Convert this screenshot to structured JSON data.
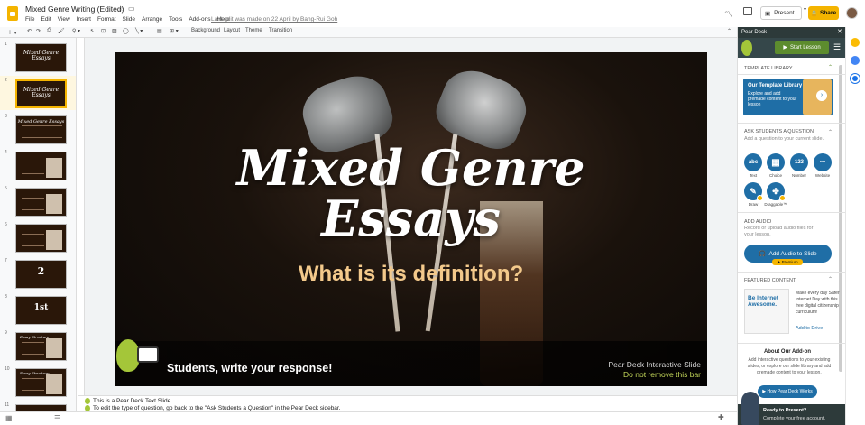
{
  "titlebar": {
    "doc_title": "Mixed Genre Writing (Edited)",
    "menus": [
      "File",
      "Edit",
      "View",
      "Insert",
      "Format",
      "Slide",
      "Arrange",
      "Tools",
      "Add-ons",
      "Help"
    ],
    "last_edit": "Last edit was made on 22 April by Bang-Rui Goh",
    "present_label": "Present",
    "share_label": "Share"
  },
  "toolbar": {
    "background_label": "Background",
    "layout_label": "Layout",
    "theme_label": "Theme",
    "transition_label": "Transition"
  },
  "slides": [
    {
      "num": "1",
      "title": "Mixed Genre Essays",
      "kind": "title"
    },
    {
      "num": "2",
      "title": "Mixed Genre Essays",
      "kind": "title"
    },
    {
      "num": "3",
      "title": "Mixed Genre Essays",
      "kind": "text"
    },
    {
      "num": "4",
      "title": "",
      "kind": "text-image"
    },
    {
      "num": "5",
      "title": "",
      "kind": "text-image"
    },
    {
      "num": "6",
      "title": "",
      "kind": "text-image"
    },
    {
      "num": "7",
      "title": "2",
      "kind": "number"
    },
    {
      "num": "8",
      "title": "1st",
      "kind": "number"
    },
    {
      "num": "9",
      "title": "Essay Structure",
      "kind": "text-image"
    },
    {
      "num": "10",
      "title": "Essay Structure",
      "kind": "text-image"
    },
    {
      "num": "11",
      "title": "",
      "kind": "title"
    }
  ],
  "slide": {
    "title_line1": "Mixed Genre",
    "title_line2": "Essays",
    "subtitle": "What is its definition?",
    "respond": "Students, write your response!",
    "pd_interactive": "Pear Deck Interactive Slide",
    "pd_notremove": "Do not remove this bar"
  },
  "notes": {
    "line1": "This is a Pear Deck Text Slide",
    "line2": "To edit the type of question, go back to the \"Ask Students a Question\" in the Pear Deck sidebar."
  },
  "sidebar": {
    "header": "Pear Deck",
    "start_lesson": "Start Lesson",
    "template_library": "TEMPLATE LIBRARY",
    "tl_card_title": "Our Template Library",
    "tl_card_text": "Explore and add premade content to your lesson",
    "ask_title": "ASK STUDENTS A QUESTION",
    "ask_sub": "Add a question to your current slide.",
    "questions": [
      {
        "icon": "abc",
        "label": "Text"
      },
      {
        "icon": "▦",
        "label": "Choice"
      },
      {
        "icon": "123",
        "label": "Number"
      },
      {
        "icon": "•••",
        "label": "Website"
      },
      {
        "icon": "✎",
        "label": "Draw"
      },
      {
        "icon": "✤",
        "label": "Draggable™"
      }
    ],
    "audio_title": "ADD AUDIO",
    "audio_sub1": "Record or upload audio files for",
    "audio_sub2": "your lesson.",
    "add_audio": "Add Audio to Slide",
    "premium": "★ Premium",
    "featured": "FEATURED CONTENT",
    "be_internet": "Be Internet Awesome.",
    "be_text": "Make every day Safer Internet Day with this free digital citizenship curriculum!",
    "add_drive": "Add to Drive",
    "about_title": "About Our Add-on",
    "about_text": "Add interactive questions to your existing slides, or explore our slide library and add premade content to your lesson.",
    "how_btn": "How Pear Deck Works",
    "ready_title": "Ready to Present?",
    "ready_sub": "Complete your free account."
  },
  "colors": {
    "accent": "#f4b400",
    "pd_blue": "#1f6ea6",
    "pd_green": "#a4c639"
  }
}
